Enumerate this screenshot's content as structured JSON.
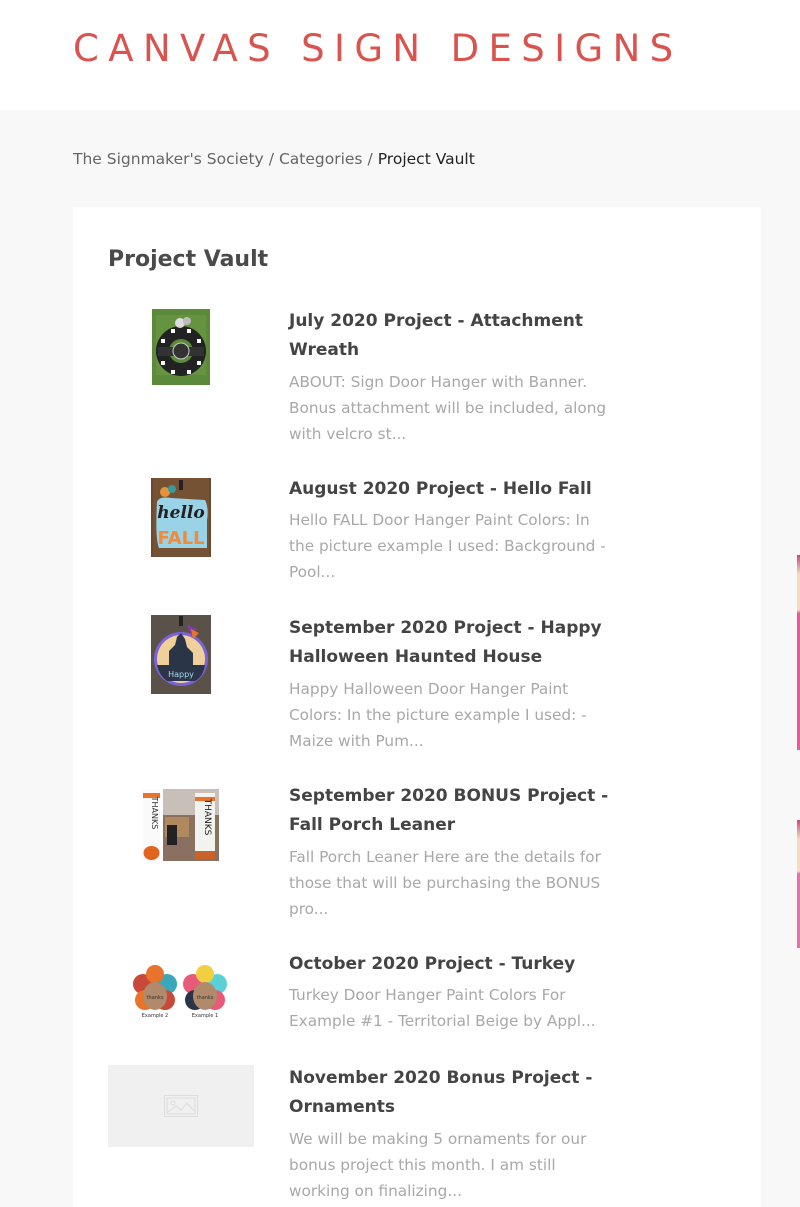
{
  "header": {
    "logo_text": "CANVAS SIGN DESIGNS",
    "brand_color": "#d9534f"
  },
  "breadcrumb": {
    "items": [
      {
        "label": "The Signmaker's Society"
      },
      {
        "label": "Categories"
      },
      {
        "label": "Project Vault"
      }
    ],
    "separator": "/"
  },
  "page": {
    "title": "Project Vault"
  },
  "projects": [
    {
      "title": "July 2020 Project - Attachment Wreath",
      "description": "ABOUT: Sign Door Hanger with Banner. Bonus attachment will be included, along with velcro st...",
      "thumbnail": "wreath-thumbnail"
    },
    {
      "title": "August 2020 Project - Hello Fall",
      "description": "Hello FALL Door Hanger Paint Colors: In the picture example I used: Background - Pool...",
      "thumbnail": "hello-fall-thumbnail"
    },
    {
      "title": "September 2020 Project - Happy Halloween Haunted House",
      "description": "Happy Halloween Door Hanger Paint Colors: In the picture example I used: - Maize with Pum...",
      "thumbnail": "haunted-house-thumbnail"
    },
    {
      "title": "September 2020 BONUS Project - Fall Porch Leaner",
      "description": "Fall Porch Leaner Here are the details for those that will be purchasing the BONUS pro...",
      "thumbnail": "porch-leaner-thumbnail"
    },
    {
      "title": "October 2020 Project - Turkey",
      "description": "Turkey Door Hanger  Paint Colors For Example #1 - Territorial Beige by Appl...",
      "thumbnail": "turkey-thumbnail",
      "thumb_labels": [
        "Example 2",
        "Example 1"
      ]
    },
    {
      "title": "November 2020 Bonus Project - Ornaments",
      "description": "We will be making 5 ornaments for our bonus project this month. I am still working on finalizing...",
      "thumbnail": "image-placeholder-icon"
    }
  ]
}
